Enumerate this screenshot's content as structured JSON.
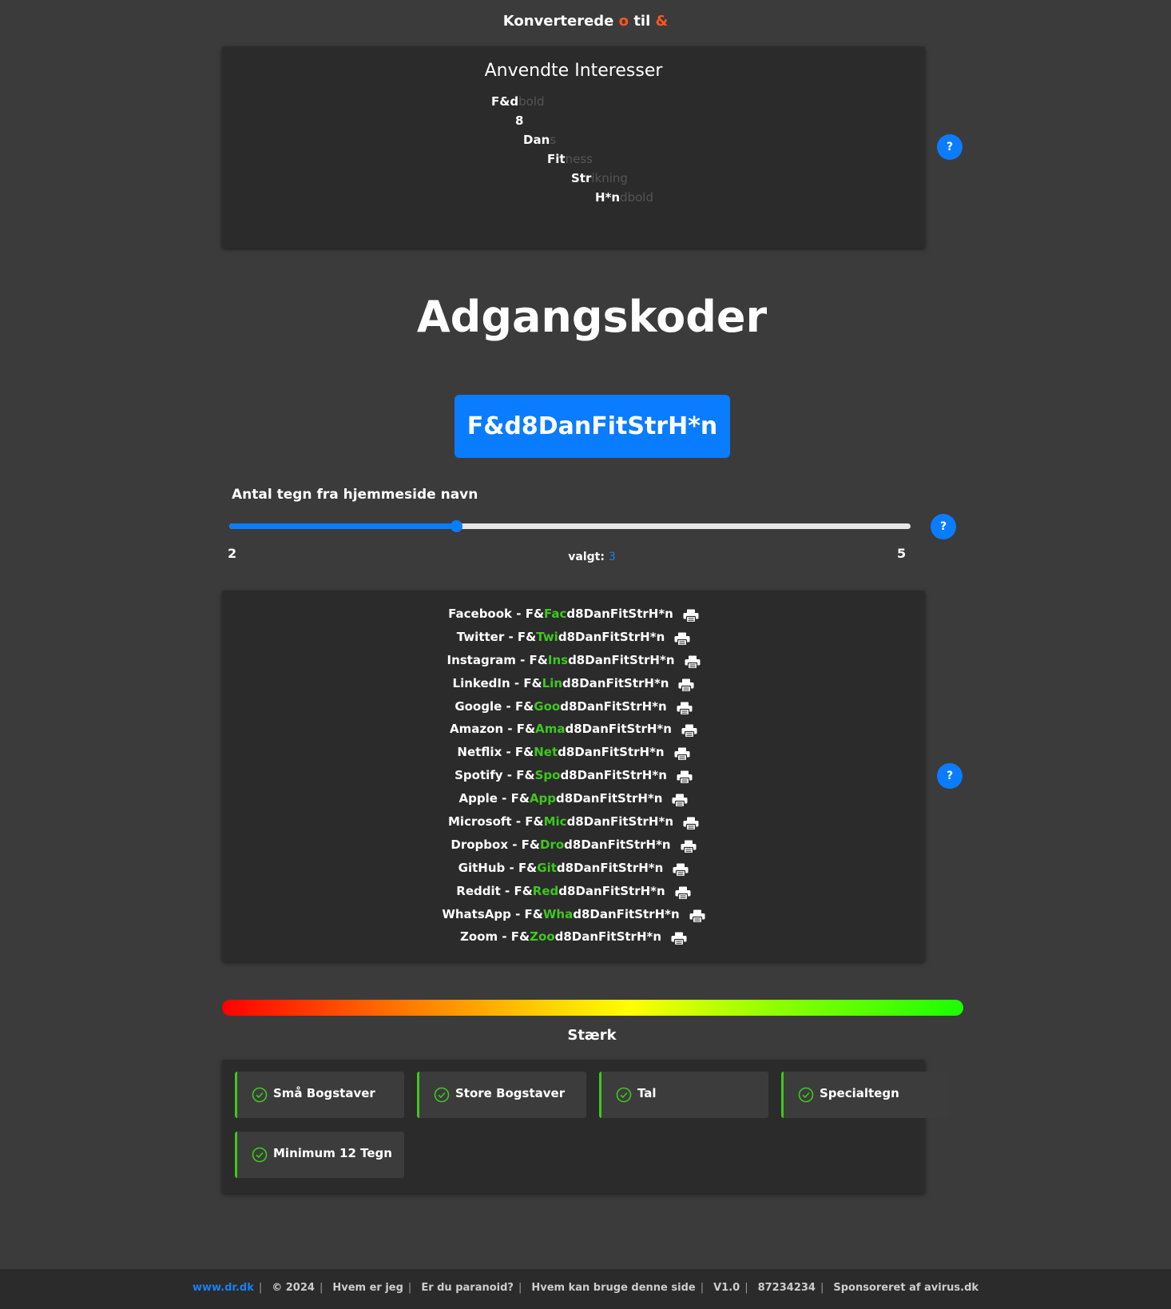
{
  "header": {
    "title_prefix": "Konverterede",
    "title_from": "o",
    "title_to_word": "til",
    "title_to": "&"
  },
  "interests": {
    "title": "Anvendte Interesser",
    "rows": [
      {
        "used": "F&d",
        "rest": "bold"
      },
      {
        "used": "8",
        "rest": ""
      },
      {
        "used": "Dan",
        "rest": "s"
      },
      {
        "used": "Fit",
        "rest": "ness"
      },
      {
        "used": "Str",
        "rest": "ikning"
      },
      {
        "used": "H*n",
        "rest": "dbold"
      }
    ]
  },
  "help_label": "?",
  "main": {
    "heading": "Adgangskoder",
    "password": "F&d8DanFitStrH*n"
  },
  "slider": {
    "label": "Antal tegn fra hjemmeside navn",
    "min": "2",
    "max": "5",
    "chosen_label": "valgt:",
    "value": "3",
    "min_value": 2,
    "max_value": 5,
    "current_value": 3
  },
  "sites": [
    {
      "name": "Facebook",
      "sep": " - ",
      "prefix": "F&",
      "mid": "Fac",
      "suffix": "d8DanFitStrH*n"
    },
    {
      "name": "Twitter",
      "sep": " - ",
      "prefix": "F&",
      "mid": "Twi",
      "suffix": "d8DanFitStrH*n"
    },
    {
      "name": "Instagram",
      "sep": " - ",
      "prefix": "F&",
      "mid": "Ins",
      "suffix": "d8DanFitStrH*n"
    },
    {
      "name": "LinkedIn",
      "sep": " - ",
      "prefix": "F&",
      "mid": "Lin",
      "suffix": "d8DanFitStrH*n"
    },
    {
      "name": "Google",
      "sep": " - ",
      "prefix": "F&",
      "mid": "Goo",
      "suffix": "d8DanFitStrH*n"
    },
    {
      "name": "Amazon",
      "sep": " - ",
      "prefix": "F&",
      "mid": "Ama",
      "suffix": "d8DanFitStrH*n"
    },
    {
      "name": "Netflix",
      "sep": " - ",
      "prefix": "F&",
      "mid": "Net",
      "suffix": "d8DanFitStrH*n"
    },
    {
      "name": "Spotify",
      "sep": " - ",
      "prefix": "F&",
      "mid": "Spo",
      "suffix": "d8DanFitStrH*n"
    },
    {
      "name": "Apple",
      "sep": " - ",
      "prefix": "F&",
      "mid": "App",
      "suffix": "d8DanFitStrH*n"
    },
    {
      "name": "Microsoft",
      "sep": " - ",
      "prefix": "F&",
      "mid": "Mic",
      "suffix": "d8DanFitStrH*n"
    },
    {
      "name": "Dropbox",
      "sep": " - ",
      "prefix": "F&",
      "mid": "Dro",
      "suffix": "d8DanFitStrH*n"
    },
    {
      "name": "GitHub",
      "sep": " - ",
      "prefix": "F&",
      "mid": "Git",
      "suffix": "d8DanFitStrH*n"
    },
    {
      "name": "Reddit",
      "sep": " - ",
      "prefix": "F&",
      "mid": "Red",
      "suffix": "d8DanFitStrH*n"
    },
    {
      "name": "WhatsApp",
      "sep": " - ",
      "prefix": "F&",
      "mid": "Wha",
      "suffix": "d8DanFitStrH*n"
    },
    {
      "name": "Zoom",
      "sep": " - ",
      "prefix": "F&",
      "mid": "Zoo",
      "suffix": "d8DanFitStrH*n"
    }
  ],
  "print_icon": "printer-icon",
  "strength": {
    "label": "Stærk",
    "checks": [
      {
        "label": "Små Bogstaver",
        "icon": "check-circle-icon"
      },
      {
        "label": "Store Bogstaver",
        "icon": "check-circle-icon"
      },
      {
        "label": "Tal",
        "icon": "check-circle-icon"
      },
      {
        "label": "Specialtegn",
        "icon": "check-circle-icon"
      },
      {
        "label": "Minimum 12 Tegn",
        "icon": "check-circle-icon"
      }
    ]
  },
  "colors": {
    "accent_blue": "#0a7cff",
    "success_green": "#3ec81e",
    "highlight_red": "#ff5522",
    "background": "#3b3b3b",
    "panel": "#2b2b2b"
  },
  "footer": {
    "items": [
      "www.dr.dk",
      "© 2024",
      "Hvem er jeg",
      "Er du paranoid?",
      "Hvem kan bruge denne side",
      "V1.0",
      "87234234",
      "Sponsoreret af avirus.dk"
    ],
    "separator": "|"
  }
}
